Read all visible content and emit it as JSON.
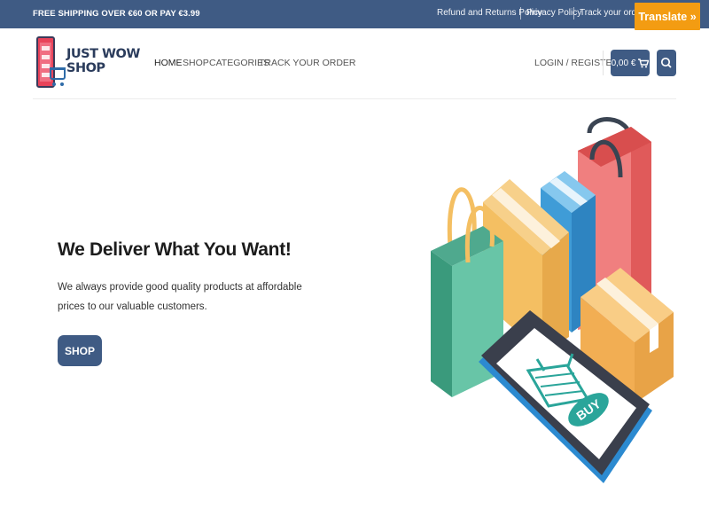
{
  "topbar": {
    "promo": "FREE SHIPPING OVER €60 OR PAY €3.99",
    "links": [
      "Refund and Returns Policy",
      "Privacy Policy",
      "Track your order"
    ],
    "translate_label": "Translate »"
  },
  "logo": {
    "line1": "JUST WOW",
    "line2": "SHOP"
  },
  "nav": {
    "items": [
      "HOME",
      "SHOP",
      "CATEGORIES",
      "TRACK YOUR ORDER"
    ]
  },
  "account": {
    "login_label": "LOGIN / REGISTER",
    "cart_total": "0,00 €"
  },
  "hero": {
    "title": "We Deliver What You Want!",
    "text": "We always provide good quality products at affordable prices to our valuable customers.",
    "button_label": "SHOP"
  },
  "illustration": {
    "phone_button": "BUY"
  },
  "colors": {
    "primary": "#3f5b84",
    "accent": "#f39c12"
  }
}
